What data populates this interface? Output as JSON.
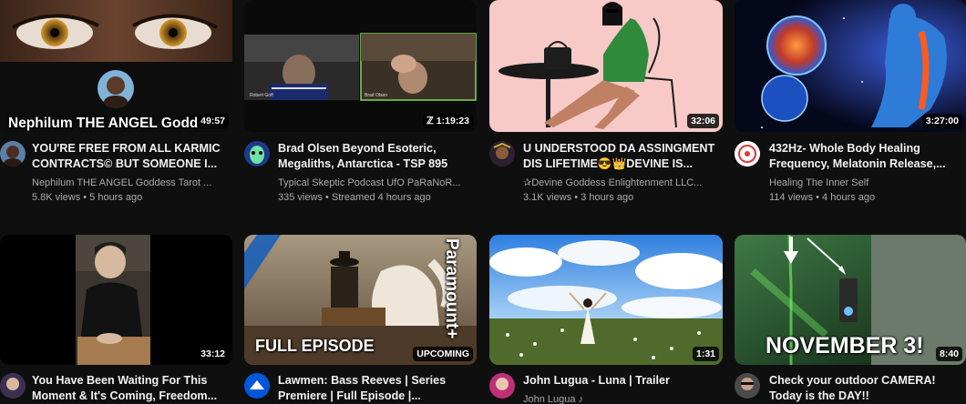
{
  "videos": [
    {
      "duration": "49:57",
      "thumb_overlay": "Nephilum THE ANGEL Godd",
      "title1": "YOU'RE FREE FROM ALL KARMIC",
      "title2": "CONTRACTS© BUT SOMEONE I...",
      "channel": "Nephilum THE ANGEL Goddess Tarot ...",
      "stats": "5.8K views • 5 hours ago"
    },
    {
      "duration": "1:19:23",
      "title1": "Brad Olsen Beyond Esoteric,",
      "title2": "Megaliths, Antarctica - TSP 895",
      "channel": "Typical Skeptic Podcast UfO PaRaNoR...",
      "stats": "335 views • Streamed 4 hours ago"
    },
    {
      "duration": "32:06",
      "title1": "U UNDERSTOOD DA ASSINGMENT",
      "title2": "DIS LIFETIME😎👑DEVINE IS...",
      "channel": "✰Devine Goddess Enlightenment LLC...",
      "stats": "3.1K views • 3 hours ago"
    },
    {
      "duration": "3:27:00",
      "title1": "432Hz- Whole Body Healing",
      "title2": "Frequency, Melatonin Release,...",
      "channel": "Healing The Inner Self",
      "stats": "114 views • 4 hours ago"
    },
    {
      "duration": "33:12",
      "title1": "You Have Been Waiting For This",
      "title2": "Moment & It's Coming, Freedom..."
    },
    {
      "duration": "UPCOMING",
      "thumb_overlay": "FULL EPISODE",
      "side_text": "Paramount+",
      "title1": "Lawmen: Bass Reeves | Series",
      "title2": "Premiere | Full Episode |..."
    },
    {
      "duration": "1:31",
      "title1": "John Lugua - Luna | Trailer",
      "channel": "John Lugua ♪"
    },
    {
      "duration": "8:40",
      "thumb_overlay": "NOVEMBER 3!",
      "title1": "Check your outdoor CAMERA!",
      "title2": "Today is the DAY!!"
    }
  ]
}
